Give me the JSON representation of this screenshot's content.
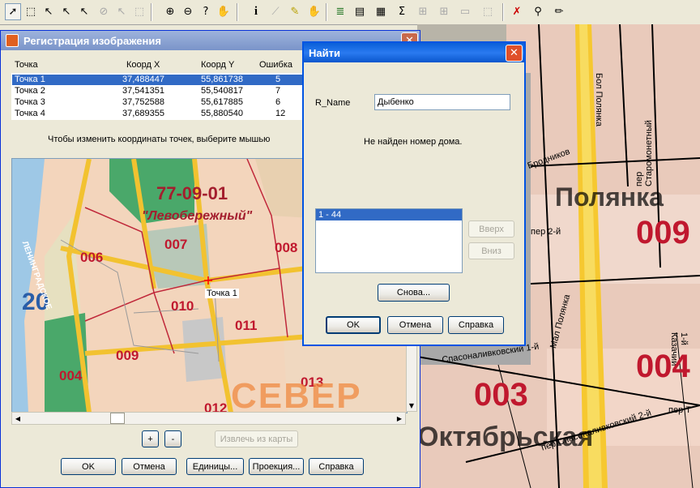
{
  "toolbar": {
    "icons": [
      "arrow",
      "select-rect",
      "select-lasso",
      "select-poly",
      "select-bound",
      "select-circle",
      "select-cursor",
      "select-cursor-box",
      "zoom-in",
      "zoom-out",
      "zoom-query",
      "pan",
      "info",
      "ruler",
      "edit-pen",
      "stamp",
      "layers",
      "legend",
      "sum",
      "tool-a",
      "tool-b",
      "tool-c",
      "tool-d",
      "tool-e",
      "wrench-red",
      "wrench",
      "pencil"
    ]
  },
  "map_labels": {
    "street_1": "пер Старомонетный",
    "street_2": "Бол Полянка",
    "street_3": "Бродников",
    "street_4": "пер 2-й",
    "street_5": "Спасоналивковский 1-й",
    "street_6": "пер Спасоналивковский 2-й",
    "street_7": "пер Т",
    "street_8": "Мал Полянка",
    "district": "Октябрьская",
    "district_top": "Полянка",
    "num_009": "009",
    "num_003": "003",
    "num_004": "004",
    "street_v": "1-й Казачий"
  },
  "reg_dialog": {
    "title": "Регистрация изображения",
    "headers": {
      "point": "Точка",
      "x": "Коорд X",
      "y": "Коорд Y",
      "err": "Ошибка"
    },
    "rows": [
      {
        "point": "Точка 1",
        "x": "37,488447",
        "y": "55,861738",
        "err": "5"
      },
      {
        "point": "Точка 2",
        "x": "37,541351",
        "y": "55,540817",
        "err": "7"
      },
      {
        "point": "Точка 3",
        "x": "37,752588",
        "y": "55,617885",
        "err": "6"
      },
      {
        "point": "Точка 4",
        "x": "37,689355",
        "y": "55,880540",
        "err": "12"
      }
    ],
    "hint": "Чтобы изменить координаты точек, выберите мышью",
    "map": {
      "district_code": "77-09-01",
      "district_name": "\"Левобережный\"",
      "nums": [
        "006",
        "007",
        "008",
        "010",
        "011",
        "009",
        "004",
        "013",
        "012"
      ],
      "road_label": "ЛЕНИНГРАДСКОЕ",
      "big_text": "СЕВЕР",
      "big_num": "20",
      "point_label": "Точка 1"
    },
    "plus": "+",
    "minus": "-",
    "extract": "Извлечь из карты",
    "ok": "OK",
    "cancel": "Отмена",
    "units": "Единицы...",
    "projection": "Проекция...",
    "help": "Справка"
  },
  "find_dialog": {
    "title": "Найти",
    "label": "R_Name",
    "value": "Дыбенко",
    "message": "Не найден номер дома.",
    "list_items": [
      "1 - 44"
    ],
    "up": "Вверх",
    "down": "Вниз",
    "again": "Снова...",
    "ok": "OK",
    "cancel": "Отмена",
    "help": "Справка"
  }
}
